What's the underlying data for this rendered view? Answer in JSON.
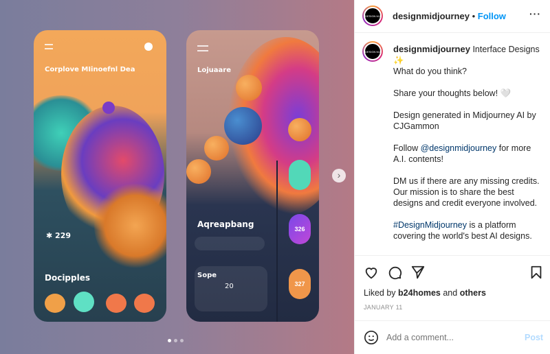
{
  "media": {
    "phone1": {
      "title": "Corplove MIinoefnl Dea",
      "stat": "229",
      "stat_icon": "gear-icon",
      "section": "Docipples"
    },
    "phone2": {
      "title": "Lojuaare",
      "heading": "Aqreapbang",
      "card_title": "Sope",
      "card_value": "20",
      "pill1": "326",
      "pill2": "327"
    },
    "carousel": {
      "current": 1,
      "total": 3
    }
  },
  "post": {
    "username": "designmidjourney",
    "follow_label": "Follow",
    "avatar_text": "DESIGN MJ",
    "caption": {
      "first": "Interface Designs ✨",
      "line2": "What do you think?",
      "line3": "Share your thoughts below! 🤍",
      "line4": "Design generated in Midjourney AI by CJGammon",
      "line5_pre": "Follow ",
      "line5_link": "@designmidjourney",
      "line5_post": " for more A.I. contents!",
      "line6": "DM us if there are any missing credits. Our mission is to share the best designs and credit everyone involved.",
      "line7_link": "#DesignMidjourney",
      "line7_post": " is a platform covering the world's best AI designs."
    },
    "likes_prefix": "Liked by ",
    "likes_user": "b24homes",
    "likes_mid": " and ",
    "likes_others": "others",
    "date": "JANUARY 11",
    "comment_placeholder": "Add a comment...",
    "post_label": "Post",
    "colors": {
      "accent": "#0095f6",
      "text": "#262626",
      "muted": "#8e8e8e"
    }
  }
}
